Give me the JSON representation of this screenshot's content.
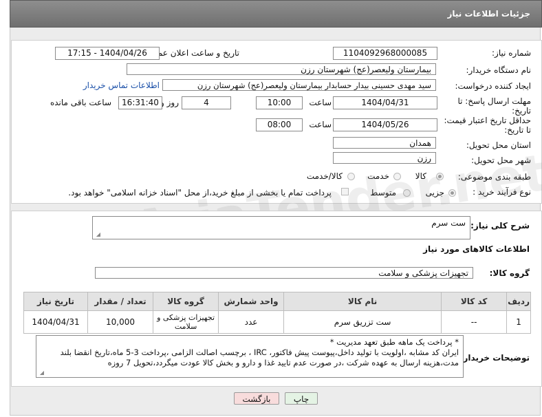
{
  "page_title": "جزئیات اطلاعات نیاز",
  "fields": {
    "need_number_label": "شماره نیاز:",
    "need_number": "1104092968000085",
    "announce_label": "تاریخ و ساعت اعلان عمومی:",
    "announce_value": "1404/04/26 - 17:15",
    "buyer_org_label": "نام دستگاه خریدار:",
    "buyer_org": "بیمارستان ولیعصر(عج) شهرستان رزن",
    "creator_label": "ایجاد کننده درخواست:",
    "creator": "سید مهدی حسینی بیدار حسابدار بیمارستان ولیعصر(عج) شهرستان رزن",
    "buyer_contact_link": "اطلاعات تماس خریدار",
    "reply_deadline_label": "مهلت ارسال پاسخ: تا تاریخ:",
    "reply_date": "1404/04/31",
    "time_label": "ساعت",
    "reply_time": "10:00",
    "days_value": "4",
    "days_label": "روز و",
    "remaining_time": "16:31:40",
    "remaining_label": "ساعت باقی مانده",
    "price_validity_label": "حداقل تاریخ اعتبار قیمت: تا تاریخ:",
    "price_date": "1404/05/26",
    "price_time": "08:00",
    "province_label": "استان محل تحویل:",
    "province": "همدان",
    "city_label": "شهر محل تحویل:",
    "city": "رزن",
    "category_label": "طبقه بندی موضوعی:",
    "category_options": [
      "کالا",
      "خدمت",
      "کالا/خدمت"
    ],
    "process_label": "نوع فرآیند خرید :",
    "process_options": [
      "جزیی",
      "متوسط"
    ],
    "payment_note": "پرداخت تمام یا بخشی از مبلغ خرید،از محل \"اسناد خزانه اسلامی\" خواهد بود."
  },
  "summary": {
    "label": "شرح کلی نیاز:",
    "value": "ست سرم",
    "items_title": "اطلاعات کالاهای مورد نیاز",
    "group_label": "گروه کالا:",
    "group_value": "تجهیزات پزشکی و سلامت"
  },
  "table": {
    "headers": [
      "ردیف",
      "کد کالا",
      "نام کالا",
      "واحد شمارش",
      "گروه کالا",
      "تعداد / مقدار",
      "تاریخ نیاز"
    ],
    "rows": [
      [
        "1",
        "--",
        "ست تزریق سرم",
        "عدد",
        "تجهیزات پزشکی و سلامت",
        "10,000",
        "1404/04/31"
      ]
    ]
  },
  "buyer_notes": {
    "label": "توضیحات خریدار:",
    "line1": "* پرداخت یک ماهه طبق تعهد مدیریت *",
    "line2": "ایران کد مشابه ،اولویت با تولید داخل،پیوست پیش فاکتور، IRC ، برچسب اصالت الزامی ،پرداخت 3-5 ماه،تاریخ انقضا بلند",
    "line3": "مدت،هزینه ارسال به عهده شرکت ،در صورت عدم تایید غذا و دارو و بخش کالا عودت میگردد،تحویل 7 روزه"
  },
  "buttons": {
    "print": "چاپ",
    "back": "بازگشت"
  },
  "watermark": "AriaTender.net",
  "colors": {
    "header_bg": "#7a7a7a",
    "link": "#1a4fa8",
    "back_button_bg": "#f6d6d6",
    "print_button_bg": "#d9f0d9"
  }
}
